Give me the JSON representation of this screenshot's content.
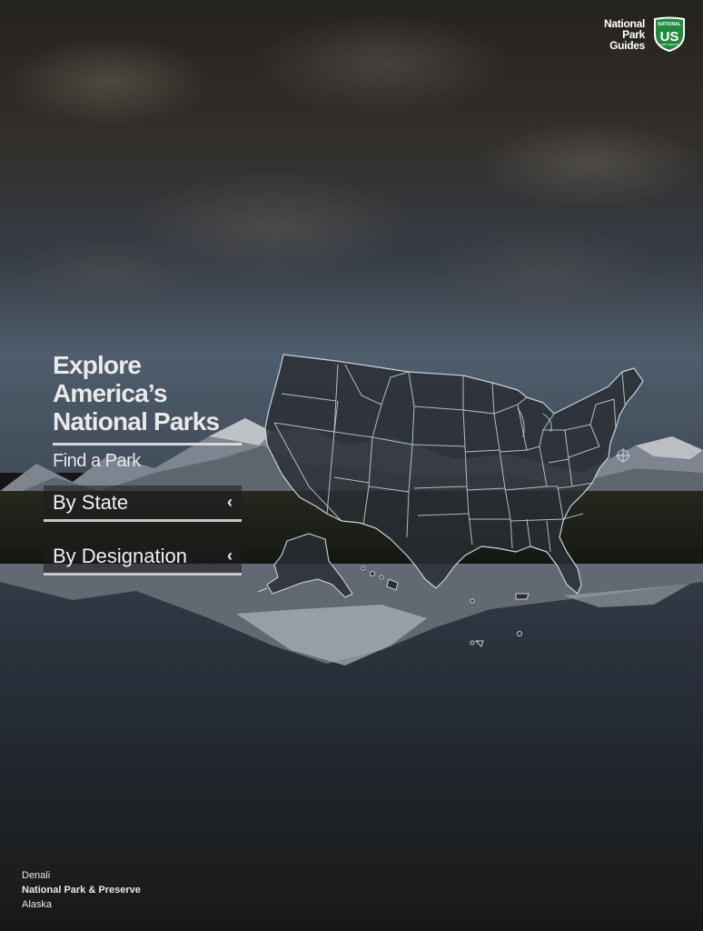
{
  "brand": {
    "line1": "National",
    "line2": "Park",
    "line3": "Guides",
    "shield_top": "NATIONAL",
    "shield_main": "US",
    "shield_bottom": "PARK SERVICE",
    "shield_color": "#1e8a3c"
  },
  "hero": {
    "line1": "Explore",
    "line2": "America’s",
    "line3": "National Parks",
    "subtitle": "Find a Park"
  },
  "menu": {
    "by_state": "By State",
    "by_designation": "By Designation",
    "chevron_icon": "chevron-left-icon"
  },
  "caption": {
    "park": "Denali",
    "designation": "National Park & Preserve",
    "state": "Alaska"
  },
  "map": {
    "region": "United States",
    "fill": "#2a2d33",
    "stroke": "#c9d3dc"
  }
}
